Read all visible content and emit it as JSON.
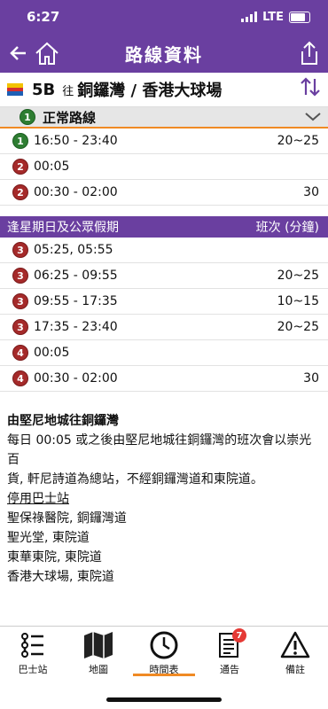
{
  "status": {
    "time": "6:27",
    "network": "LTE"
  },
  "header": {
    "title": "路線資料"
  },
  "route": {
    "number": "5B",
    "direction_prefix": "往",
    "destination": "銅鑼灣 / 香港大球場"
  },
  "section": {
    "number": "1",
    "title": "正常路線"
  },
  "normal_schedule": [
    {
      "badge": "1",
      "badge_color": "green",
      "time": "16:50 - 23:40",
      "freq": "20~25"
    },
    {
      "badge": "2",
      "badge_color": "red",
      "time": "00:05",
      "freq": ""
    },
    {
      "badge": "2",
      "badge_color": "red",
      "time": "00:30 - 02:00",
      "freq": "30"
    }
  ],
  "holiday": {
    "title": "逢星期日及公眾假期",
    "freq_header": "班次 (分鐘)"
  },
  "holiday_schedule": [
    {
      "badge": "3",
      "time": "05:25, 05:55",
      "freq": ""
    },
    {
      "badge": "3",
      "time": "06:25 - 09:55",
      "freq": "20~25"
    },
    {
      "badge": "3",
      "time": "09:55 - 17:35",
      "freq": "10~15"
    },
    {
      "badge": "3",
      "time": "17:35 - 23:40",
      "freq": "20~25"
    },
    {
      "badge": "4",
      "time": "00:05",
      "freq": ""
    },
    {
      "badge": "4",
      "time": "00:30 - 02:00",
      "freq": "30"
    }
  ],
  "notes": {
    "title": "由堅尼地城往銅鑼灣",
    "line1": "每日 00:05 或之後由堅尼地城往銅鑼灣的班次會以崇光百",
    "line2": "貨, 軒尼詩道為總站，不經銅鑼灣道和東院道。",
    "suspended_title": "停用巴士站",
    "stops": [
      "聖保祿醫院, 銅鑼灣道",
      "聖光堂, 東院道",
      "東華東院, 東院道",
      "香港大球場, 東院道"
    ]
  },
  "tabs": [
    {
      "label": "巴士站",
      "icon": "bus-stop-icon"
    },
    {
      "label": "地圖",
      "icon": "map-icon"
    },
    {
      "label": "時間表",
      "icon": "clock-icon"
    },
    {
      "label": "通告",
      "icon": "notice-icon",
      "badge": "7"
    },
    {
      "label": "備註",
      "icon": "warning-icon"
    }
  ],
  "colors": {
    "brand": "#6a3fa0",
    "accent": "#f08a24"
  }
}
